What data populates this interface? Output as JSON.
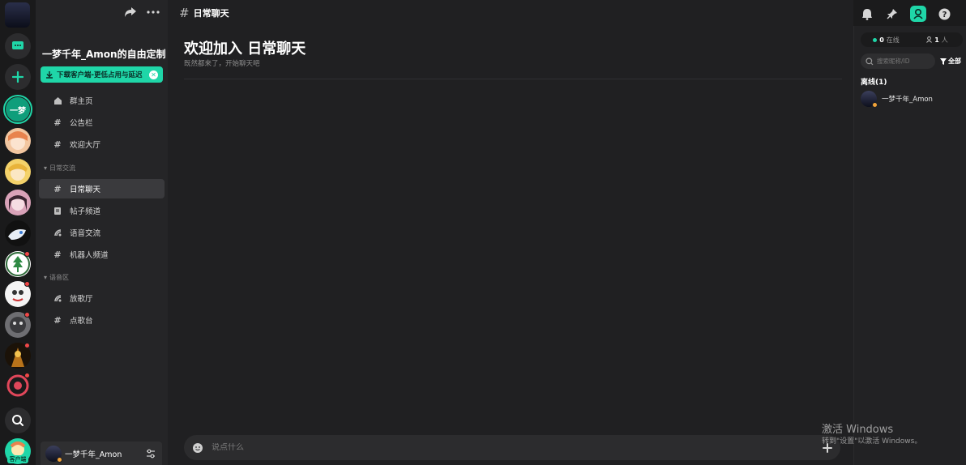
{
  "server": {
    "name": "一梦千年_Amon的自由定制",
    "download_banner": "下载客户端-更低占用与延迟",
    "active_server_short": "一梦",
    "client_label": "客户端"
  },
  "channels": {
    "top": [
      {
        "label": "群主页",
        "icon": "home-icon"
      },
      {
        "label": "公告栏",
        "icon": "hash-icon"
      },
      {
        "label": "欢迎大厅",
        "icon": "hash-icon"
      }
    ],
    "categories": [
      {
        "name": "日常交流",
        "items": [
          {
            "label": "日常聊天",
            "icon": "hash-icon",
            "active": true
          },
          {
            "label": "帖子频道",
            "icon": "post-icon"
          },
          {
            "label": "语音交流",
            "icon": "voice-icon"
          },
          {
            "label": "机器人频道",
            "icon": "hash-icon"
          }
        ]
      },
      {
        "name": "语音区",
        "items": [
          {
            "label": "放歌厅",
            "icon": "voice-icon"
          },
          {
            "label": "点歌台",
            "icon": "hash-icon"
          }
        ]
      }
    ]
  },
  "user": {
    "name": "一梦千年_Amon"
  },
  "header": {
    "channel": "日常聊天"
  },
  "welcome": {
    "title": "欢迎加入 日常聊天",
    "subtitle": "既然都来了，开始聊天吧"
  },
  "composer": {
    "placeholder": "说点什么"
  },
  "members": {
    "online_count": "0",
    "online_label": "在线",
    "total_count": "1",
    "total_label": "人",
    "search_placeholder": "搜索昵称/ID",
    "filter_label": "全部",
    "group": "离线(1)",
    "list": [
      {
        "name": "一梦千年_Amon"
      }
    ]
  },
  "watermark": {
    "line1": "激活 Windows",
    "line2": "转到\"设置\"以激活 Windows。"
  },
  "colors": {
    "accent": "#1fd6a8",
    "unread": "#f04747",
    "idle": "#f2a33a"
  }
}
